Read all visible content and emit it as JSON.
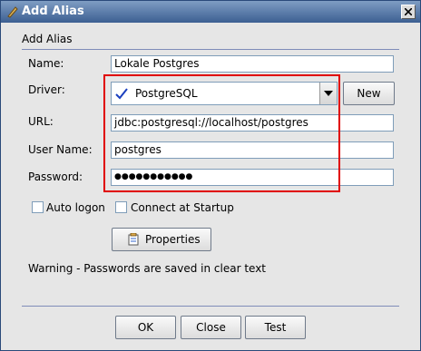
{
  "window": {
    "title": "Add Alias",
    "close_label": "close"
  },
  "section": {
    "title": "Add Alias"
  },
  "fields": {
    "name_label": "Name:",
    "name_value": "Lokale Postgres",
    "driver_label": "Driver:",
    "driver_value": "PostgreSQL",
    "new_button": "New",
    "url_label": "URL:",
    "url_value": "jdbc:postgresql://localhost/postgres",
    "username_label": "User Name:",
    "username_value": "postgres",
    "password_label": "Password:",
    "password_value": "●●●●●●●●●●●"
  },
  "options": {
    "auto_logon": "Auto logon",
    "auto_logon_checked": false,
    "connect_startup": "Connect at Startup",
    "connect_startup_checked": false
  },
  "properties_button": "Properties",
  "warning": "Warning - Passwords are saved in clear text",
  "buttons": {
    "ok": "OK",
    "close": "Close",
    "test": "Test"
  },
  "colors": {
    "highlight": "#e00000",
    "titlebar": "#3c5f92",
    "check": "#1a3fbf"
  }
}
